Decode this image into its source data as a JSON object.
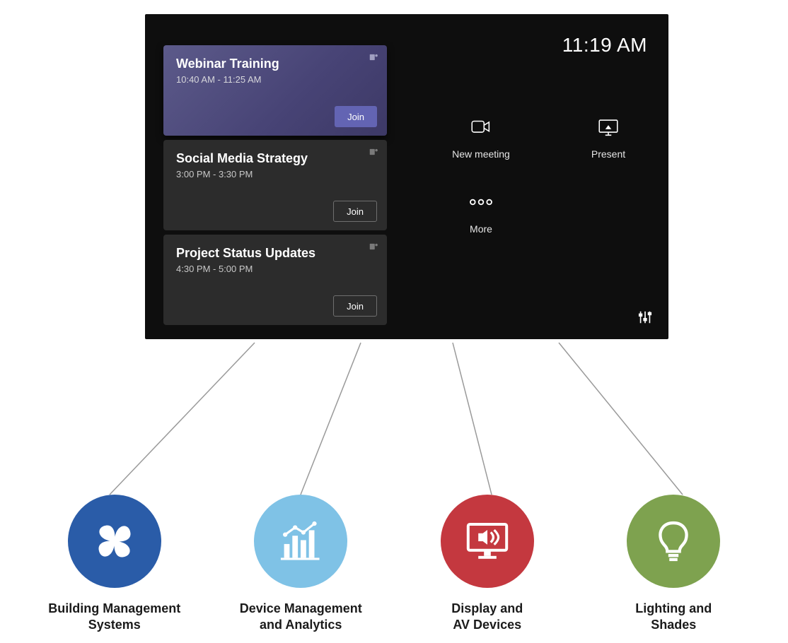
{
  "panel": {
    "clock": "11:19 AM",
    "meetings": [
      {
        "title": "Webinar Training",
        "time": "10:40 AM - 11:25 AM",
        "join": "Join",
        "highlight": true
      },
      {
        "title": "Social Media Strategy",
        "time": "3:00 PM - 3:30 PM",
        "join": "Join",
        "highlight": false
      },
      {
        "title": "Project Status Updates",
        "time": "4:30 PM - 5:00 PM",
        "join": "Join",
        "highlight": false
      }
    ],
    "actions": {
      "new_meeting": "New meeting",
      "present": "Present",
      "more": "More"
    }
  },
  "features": [
    {
      "line1": "Building Management",
      "line2": "Systems",
      "color": "blue"
    },
    {
      "line1": "Device Management",
      "line2": "and Analytics",
      "color": "light"
    },
    {
      "line1": "Display and",
      "line2": "AV Devices",
      "color": "red"
    },
    {
      "line1": "Lighting and",
      "line2": "Shades",
      "color": "green"
    }
  ]
}
